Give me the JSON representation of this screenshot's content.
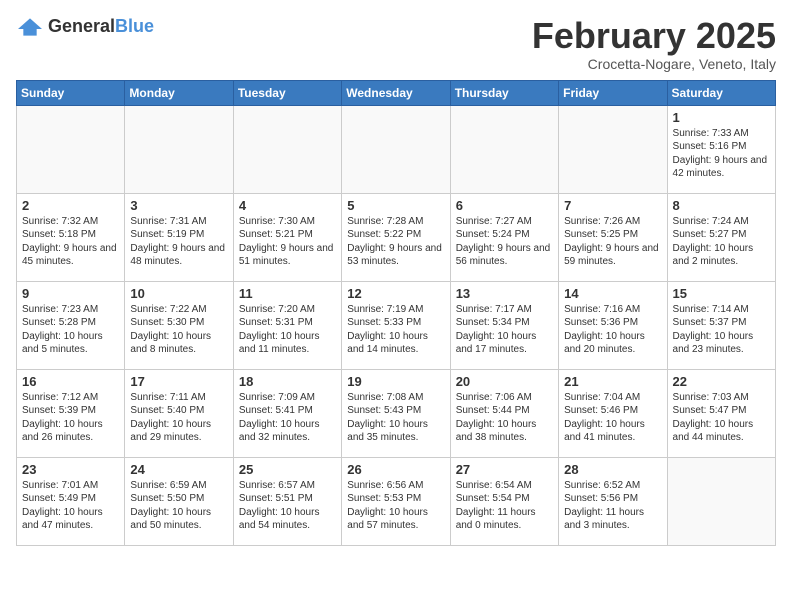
{
  "header": {
    "logo_general": "General",
    "logo_blue": "Blue",
    "month_title": "February 2025",
    "location": "Crocetta-Nogare, Veneto, Italy"
  },
  "days_of_week": [
    "Sunday",
    "Monday",
    "Tuesday",
    "Wednesday",
    "Thursday",
    "Friday",
    "Saturday"
  ],
  "weeks": [
    [
      {
        "day": "",
        "info": ""
      },
      {
        "day": "",
        "info": ""
      },
      {
        "day": "",
        "info": ""
      },
      {
        "day": "",
        "info": ""
      },
      {
        "day": "",
        "info": ""
      },
      {
        "day": "",
        "info": ""
      },
      {
        "day": "1",
        "info": "Sunrise: 7:33 AM\nSunset: 5:16 PM\nDaylight: 9 hours and 42 minutes."
      }
    ],
    [
      {
        "day": "2",
        "info": "Sunrise: 7:32 AM\nSunset: 5:18 PM\nDaylight: 9 hours and 45 minutes."
      },
      {
        "day": "3",
        "info": "Sunrise: 7:31 AM\nSunset: 5:19 PM\nDaylight: 9 hours and 48 minutes."
      },
      {
        "day": "4",
        "info": "Sunrise: 7:30 AM\nSunset: 5:21 PM\nDaylight: 9 hours and 51 minutes."
      },
      {
        "day": "5",
        "info": "Sunrise: 7:28 AM\nSunset: 5:22 PM\nDaylight: 9 hours and 53 minutes."
      },
      {
        "day": "6",
        "info": "Sunrise: 7:27 AM\nSunset: 5:24 PM\nDaylight: 9 hours and 56 minutes."
      },
      {
        "day": "7",
        "info": "Sunrise: 7:26 AM\nSunset: 5:25 PM\nDaylight: 9 hours and 59 minutes."
      },
      {
        "day": "8",
        "info": "Sunrise: 7:24 AM\nSunset: 5:27 PM\nDaylight: 10 hours and 2 minutes."
      }
    ],
    [
      {
        "day": "9",
        "info": "Sunrise: 7:23 AM\nSunset: 5:28 PM\nDaylight: 10 hours and 5 minutes."
      },
      {
        "day": "10",
        "info": "Sunrise: 7:22 AM\nSunset: 5:30 PM\nDaylight: 10 hours and 8 minutes."
      },
      {
        "day": "11",
        "info": "Sunrise: 7:20 AM\nSunset: 5:31 PM\nDaylight: 10 hours and 11 minutes."
      },
      {
        "day": "12",
        "info": "Sunrise: 7:19 AM\nSunset: 5:33 PM\nDaylight: 10 hours and 14 minutes."
      },
      {
        "day": "13",
        "info": "Sunrise: 7:17 AM\nSunset: 5:34 PM\nDaylight: 10 hours and 17 minutes."
      },
      {
        "day": "14",
        "info": "Sunrise: 7:16 AM\nSunset: 5:36 PM\nDaylight: 10 hours and 20 minutes."
      },
      {
        "day": "15",
        "info": "Sunrise: 7:14 AM\nSunset: 5:37 PM\nDaylight: 10 hours and 23 minutes."
      }
    ],
    [
      {
        "day": "16",
        "info": "Sunrise: 7:12 AM\nSunset: 5:39 PM\nDaylight: 10 hours and 26 minutes."
      },
      {
        "day": "17",
        "info": "Sunrise: 7:11 AM\nSunset: 5:40 PM\nDaylight: 10 hours and 29 minutes."
      },
      {
        "day": "18",
        "info": "Sunrise: 7:09 AM\nSunset: 5:41 PM\nDaylight: 10 hours and 32 minutes."
      },
      {
        "day": "19",
        "info": "Sunrise: 7:08 AM\nSunset: 5:43 PM\nDaylight: 10 hours and 35 minutes."
      },
      {
        "day": "20",
        "info": "Sunrise: 7:06 AM\nSunset: 5:44 PM\nDaylight: 10 hours and 38 minutes."
      },
      {
        "day": "21",
        "info": "Sunrise: 7:04 AM\nSunset: 5:46 PM\nDaylight: 10 hours and 41 minutes."
      },
      {
        "day": "22",
        "info": "Sunrise: 7:03 AM\nSunset: 5:47 PM\nDaylight: 10 hours and 44 minutes."
      }
    ],
    [
      {
        "day": "23",
        "info": "Sunrise: 7:01 AM\nSunset: 5:49 PM\nDaylight: 10 hours and 47 minutes."
      },
      {
        "day": "24",
        "info": "Sunrise: 6:59 AM\nSunset: 5:50 PM\nDaylight: 10 hours and 50 minutes."
      },
      {
        "day": "25",
        "info": "Sunrise: 6:57 AM\nSunset: 5:51 PM\nDaylight: 10 hours and 54 minutes."
      },
      {
        "day": "26",
        "info": "Sunrise: 6:56 AM\nSunset: 5:53 PM\nDaylight: 10 hours and 57 minutes."
      },
      {
        "day": "27",
        "info": "Sunrise: 6:54 AM\nSunset: 5:54 PM\nDaylight: 11 hours and 0 minutes."
      },
      {
        "day": "28",
        "info": "Sunrise: 6:52 AM\nSunset: 5:56 PM\nDaylight: 11 hours and 3 minutes."
      },
      {
        "day": "",
        "info": ""
      }
    ]
  ]
}
